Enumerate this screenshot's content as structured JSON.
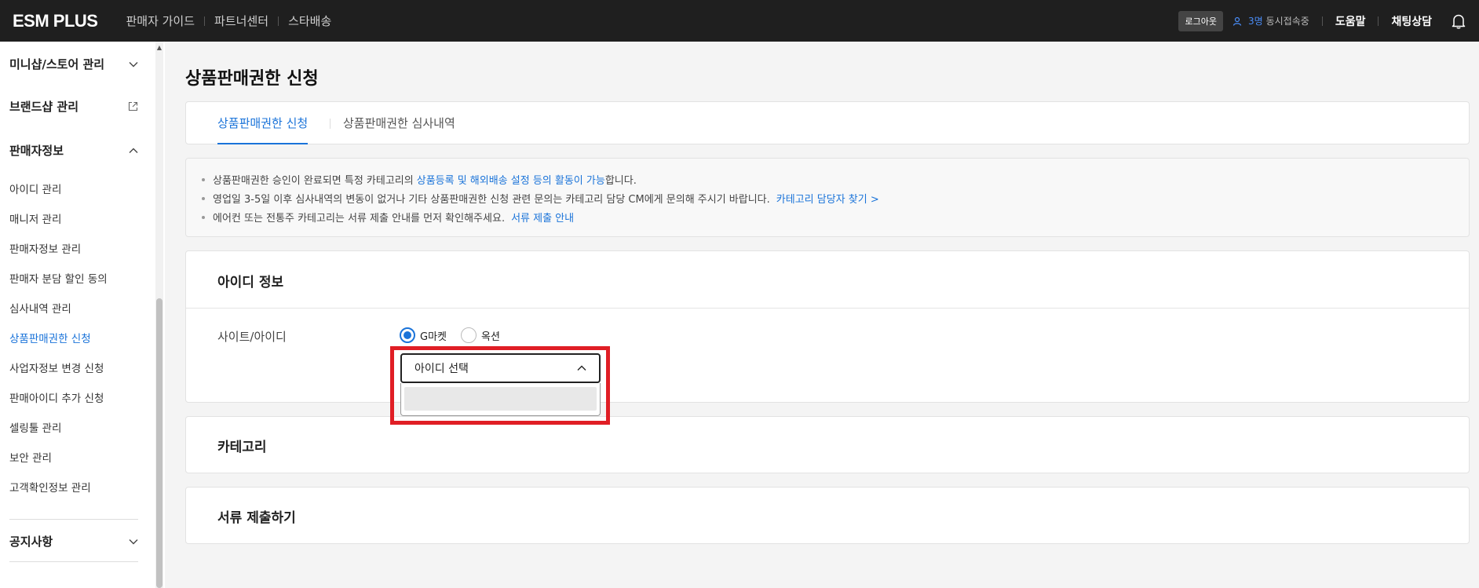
{
  "topbar": {
    "logo": "ESM PLUS",
    "nav": [
      "판매자 가이드",
      "파트너센터",
      "스타배송"
    ],
    "logout_label": "로그아웃",
    "user_count": "3명",
    "concurrent_label": "동시접속중",
    "help_label": "도움말",
    "chat_label": "채팅상담"
  },
  "sidebar": {
    "groups": {
      "minishop": "미니샵/스토어 관리",
      "brandshop": "브랜드샵 관리",
      "seller_info": "판매자정보",
      "notice": "공지사항"
    },
    "items": [
      "아이디 관리",
      "매니저 관리",
      "판매자정보 관리",
      "판매자 분담 할인 동의",
      "심사내역 관리",
      "상품판매권한 신청",
      "사업자정보 변경 신청",
      "판매아이디 추가 신청",
      "셀링툴 관리",
      "보안 관리",
      "고객확인정보 관리"
    ],
    "active_item": "상품판매권한 신청"
  },
  "main": {
    "page_title": "상품판매권한 신청",
    "tabs": [
      "상품판매권한 신청",
      "상품판매권한 심사내역"
    ],
    "notice": {
      "line1_prefix": "상품판매권한 승인이 완료되면 특정 카테고리의",
      "line1_link": "상품등록 및 해외배송 설정 등의 활동이 가능",
      "line1_suffix": "합니다.",
      "line2_text": "영업일 3-5일 이후 심사내역의 변동이 없거나 기타 상품판매권한 신청 관련 문의는 카테고리 담당 CM에게 문의해 주시기 바랍니다.",
      "line2_link": "카테고리 담당자 찾기 >",
      "line3_text": "에어컨 또는 전통주 카테고리는 서류 제출 안내를 먼저 확인해주세요.",
      "line3_link": "서류 제출 안내"
    },
    "id_section": {
      "title": "아이디 정보",
      "site_label": "사이트/아이디",
      "radio_gmarket": "G마켓",
      "radio_auction": "옥션",
      "selected_site": "G마켓",
      "select_placeholder": "아이디 선택"
    },
    "category_title": "카테고리",
    "documents_title": "서류 제출하기"
  },
  "colors": {
    "accent": "#1a73d9",
    "topbar": "#1f1f1f",
    "highlight": "#e01e25"
  }
}
